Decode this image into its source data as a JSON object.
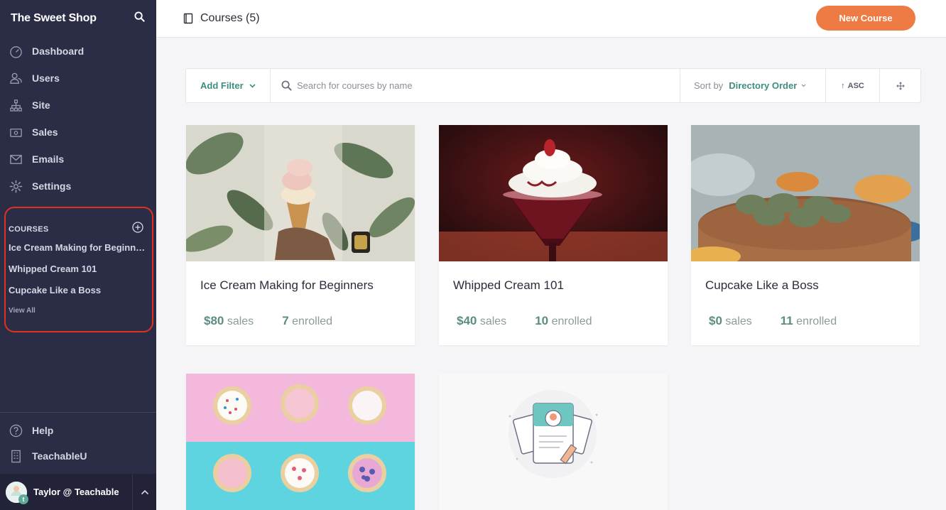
{
  "app": {
    "name": "The Sweet Shop"
  },
  "sidebar": {
    "nav": [
      {
        "label": "Dashboard",
        "icon": "dashboard-icon"
      },
      {
        "label": "Users",
        "icon": "users-icon"
      },
      {
        "label": "Site",
        "icon": "site-icon"
      },
      {
        "label": "Sales",
        "icon": "sales-icon"
      },
      {
        "label": "Emails",
        "icon": "emails-icon"
      },
      {
        "label": "Settings",
        "icon": "settings-icon"
      }
    ],
    "courses_title": "COURSES",
    "courses": [
      "Ice Cream Making for Beginners",
      "Whipped Cream 101",
      "Cupcake Like a Boss"
    ],
    "view_all": "View All",
    "bottom": [
      {
        "label": "Help",
        "icon": "help-icon"
      },
      {
        "label": "TeachableU",
        "icon": "teachableu-icon"
      }
    ],
    "user": {
      "name": "Taylor @ Teachable",
      "badge": "t"
    }
  },
  "header": {
    "title": "Courses (5)",
    "new_course_label": "New Course"
  },
  "filters": {
    "add_filter": "Add Filter",
    "search_placeholder": "Search for courses by name",
    "sort_by_label": "Sort by",
    "sort_value": "Directory Order",
    "order": "ASC"
  },
  "courses": [
    {
      "title": "Ice Cream Making for Beginners",
      "sales": "$80",
      "sales_label": "sales",
      "enrolled": "7",
      "enrolled_label": "enrolled"
    },
    {
      "title": "Whipped Cream 101",
      "sales": "$40",
      "sales_label": "sales",
      "enrolled": "10",
      "enrolled_label": "enrolled"
    },
    {
      "title": "Cupcake Like a Boss",
      "sales": "$0",
      "sales_label": "sales",
      "enrolled": "11",
      "enrolled_label": "enrolled"
    }
  ],
  "colors": {
    "sidebar": "#2b2d47",
    "accent": "#ee7a44",
    "link": "#3d8f7f",
    "highlight": "#e0301e"
  }
}
